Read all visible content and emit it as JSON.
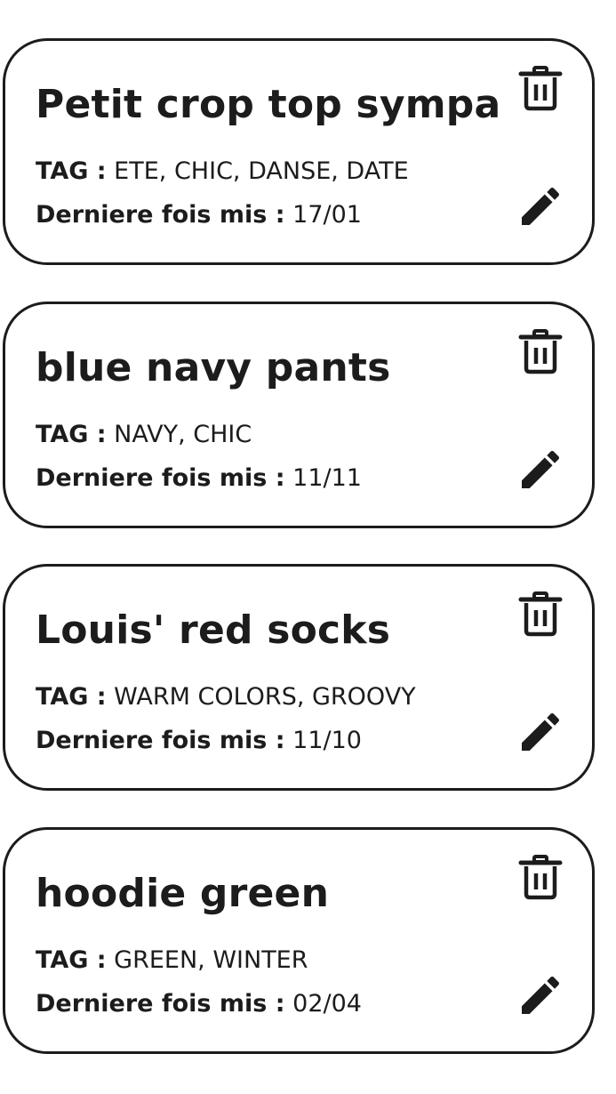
{
  "tag_label": "TAG :",
  "last_worn_label": "Derniere fois mis :",
  "items": [
    {
      "title": "Petit crop top sympa",
      "tags": "ETE, CHIC, DANSE, DATE",
      "last_worn": "17/01"
    },
    {
      "title": "blue navy pants",
      "tags": "NAVY, CHIC",
      "last_worn": "11/11"
    },
    {
      "title": "Louis' red socks",
      "tags": "WARM COLORS, GROOVY",
      "last_worn": "11/10"
    },
    {
      "title": "hoodie green",
      "tags": "GREEN, WINTER",
      "last_worn": "02/04"
    }
  ],
  "icons": {
    "delete": "trash-icon",
    "edit": "pencil-icon"
  },
  "colors": {
    "text": "#1c1c1c",
    "border": "#1c1c1c",
    "background": "#ffffff"
  }
}
